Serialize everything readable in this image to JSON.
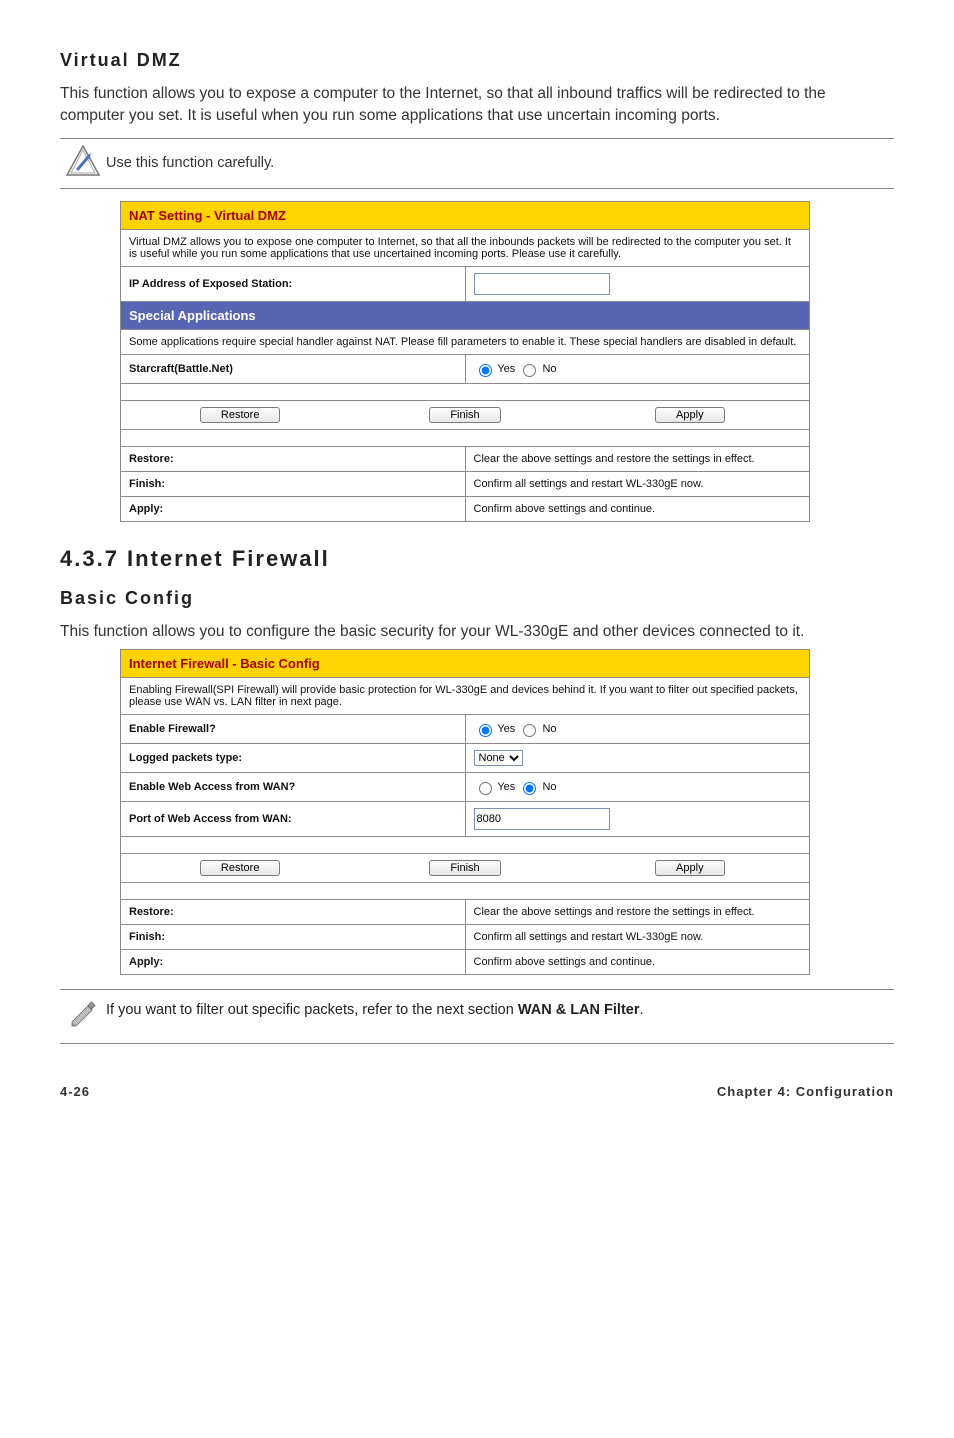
{
  "dmz": {
    "heading": "Virtual DMZ",
    "para": "This function allows you to expose a computer to the Internet, so that all inbound traffics will be redirected to the computer you set. It is useful when you run some applications that use uncertain incoming ports.",
    "callout": "Use this function carefully."
  },
  "dmz_panel": {
    "title": "NAT Setting - Virtual DMZ",
    "desc": "Virtual DMZ allows you to expose one computer to Internet, so that all the inbounds packets will be redirected to the computer you set. It is useful while you run some applications that use uncertained incoming ports. Please use it carefully.",
    "ip_label": "IP Address of Exposed Station:",
    "ip_value": "",
    "special_title": "Special Applications",
    "special_desc": "Some applications require special handler against NAT. Please fill parameters to enable it. These special handlers are disabled in default.",
    "starcraft_label": "Starcraft(Battle.Net)",
    "yes": "Yes",
    "no": "No"
  },
  "buttons": {
    "restore": "Restore",
    "finish": "Finish",
    "apply": "Apply"
  },
  "defs": {
    "restore_label": "Restore:",
    "restore_text": "Clear the above settings and restore the settings in effect.",
    "finish_label": "Finish:",
    "finish_text": "Confirm all settings and restart WL-330gE now.",
    "apply_label": "Apply:",
    "apply_text": "Confirm above settings and continue."
  },
  "fw": {
    "num_heading": "4.3.7   Internet Firewall",
    "sub_heading": "Basic Config",
    "para": "This function allows you to configure the basic security for your WL-330gE and other devices connected to it."
  },
  "fw_panel": {
    "title": "Internet Firewall - Basic Config",
    "desc": "Enabling Firewall(SPI Firewall) will provide basic protection for WL-330gE and devices behind it. If you want to filter out specified packets, please use WAN vs. LAN filter in next page.",
    "enable_label": "Enable Firewall?",
    "logged_label": "Logged packets type:",
    "logged_value": "None",
    "web_label": "Enable Web Access from WAN?",
    "port_label": "Port of Web Access from WAN:",
    "port_value": "8080",
    "yes": "Yes",
    "no": "No"
  },
  "note": {
    "prefix": "If you want to filter out specific packets, refer to the next section ",
    "bold": "WAN & LAN Filter",
    "suffix": "."
  },
  "footer": {
    "left": "4-26",
    "right": "Chapter 4: Configuration"
  }
}
